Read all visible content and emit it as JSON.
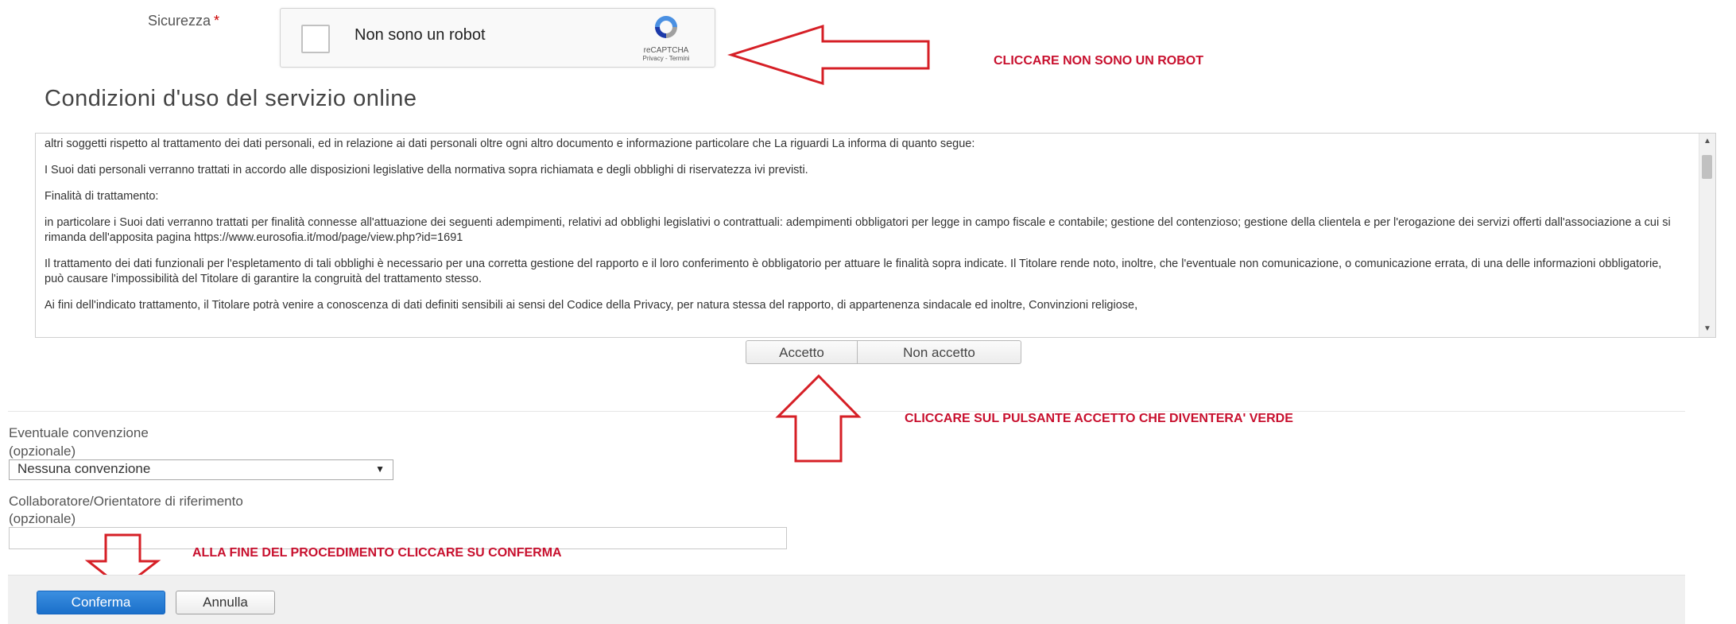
{
  "security": {
    "label": "Sicurezza",
    "required_mark": "*",
    "captcha_text": "Non sono un robot",
    "captcha_brand": "reCAPTCHA",
    "captcha_links": "Privacy - Termini"
  },
  "annotations": {
    "robot_note": "CLICCARE NON SONO UN ROBOT",
    "accept_note": "CLICCARE SUL PULSANTE ACCETTO CHE DIVENTERA' VERDE",
    "confirm_note": "ALLA FINE DEL PROCEDIMENTO CLICCARE SU CONFERMA",
    "arrow_color": "#d61f26"
  },
  "terms": {
    "title": "Condizioni d'uso del servizio online",
    "paragraphs": [
      "altri soggetti rispetto al trattamento dei dati personali, ed in relazione ai dati personali oltre ogni altro documento e informazione particolare che La riguardi La informa di quanto segue:",
      "I Suoi dati personali verranno trattati in accordo alle disposizioni legislative della normativa sopra richiamata e degli obblighi di riservatezza ivi previsti.",
      "Finalità di trattamento:",
      "in particolare i Suoi dati verranno trattati per finalità connesse all'attuazione dei seguenti adempimenti, relativi ad obblighi legislativi o contrattuali: adempimenti obbligatori per legge in campo fiscale e contabile; gestione del contenzioso; gestione della clientela e per l'erogazione dei servizi offerti dall'associazione a cui si rimanda dell'apposita pagina https://www.eurosofia.it/mod/page/view.php?id=1691",
      "Il trattamento dei dati funzionali per l'espletamento di tali obblighi è necessario per una corretta gestione del rapporto e il loro conferimento è obbligatorio per attuare le finalità sopra indicate. Il Titolare rende noto, inoltre, che l'eventuale non comunicazione, o comunicazione errata, di una delle informazioni obbligatorie, può causare l'impossibilità del Titolare di garantire la congruità del trattamento stesso.",
      "Ai fini dell'indicato trattamento, il Titolare potrà venire a conoscenza di dati definiti sensibili ai sensi del Codice della Privacy, per natura stessa del rapporto, di appartenenza sindacale ed inoltre, Convinzioni religiose,"
    ],
    "accept_label": "Accetto",
    "decline_label": "Non accetto"
  },
  "form": {
    "convention_label": "Eventuale convenzione",
    "convention_optional": "(opzionale)",
    "convention_value": "Nessuna convenzione",
    "collaborator_label": "Collaboratore/Orientatore di riferimento",
    "collaborator_optional": "(opzionale)",
    "collaborator_value": ""
  },
  "footer": {
    "confirm_label": "Conferma",
    "cancel_label": "Annulla"
  }
}
